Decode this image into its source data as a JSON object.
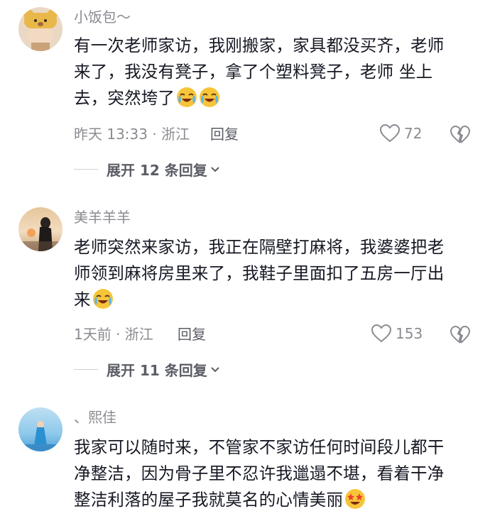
{
  "comments": [
    {
      "username": "小饭包～",
      "lines": [
        "有一次老师家访，我刚搬家，家具都没买齐，老师",
        "来了，我没有凳子，拿了个塑料凳子，老师 坐上",
        "去，突然垮了"
      ],
      "emoji": [
        "tearful-laugh-emoji",
        "tearful-laugh-emoji"
      ],
      "meta": "昨天 13:33 · 浙江",
      "reply_label": "回复",
      "likes": "72",
      "expand_label": "展开 12 条回复"
    },
    {
      "username": "美羊羊羊",
      "lines": [
        "老师突然来家访，我正在隔壁打麻将，我婆婆把老",
        "师领到麻将房里来了，我鞋子里面扣了五房一厅出",
        "来"
      ],
      "emoji": [
        "tearful-laugh-emoji"
      ],
      "meta": "1天前 · 浙江",
      "reply_label": "回复",
      "likes": "153",
      "expand_label": "展开 11 条回复"
    },
    {
      "username": "、熙佳",
      "lines": [
        "我家可以随时来，不管家不家访任何时间段儿都干",
        "净整洁，因为骨子里不忍许我邋遢不堪，看着干净",
        "整洁利落的屋子我就莫名的心情美丽"
      ],
      "emoji": [
        "star-struck-emoji"
      ]
    }
  ],
  "colors": {
    "secondary_text": "#8a8b91",
    "primary_text": "#161823",
    "emoji_face": "#f7c43a"
  }
}
